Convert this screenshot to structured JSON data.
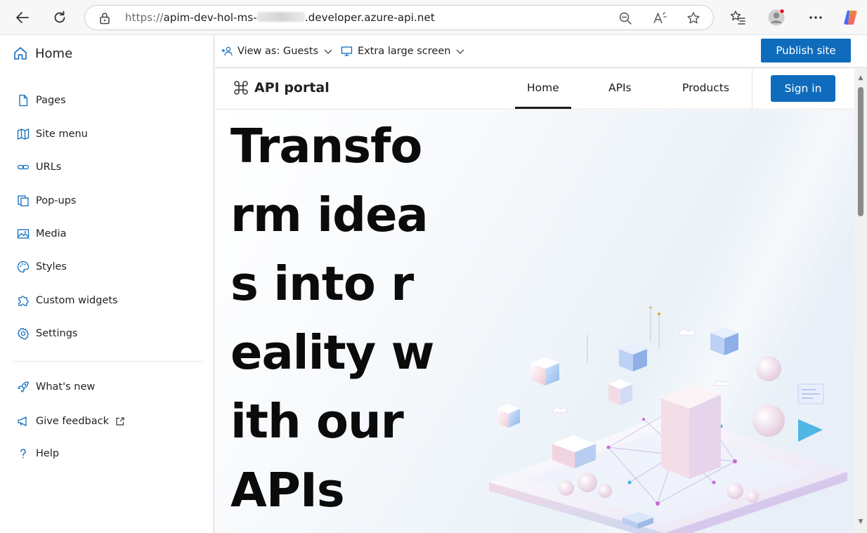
{
  "browser": {
    "url_protocol": "https://",
    "url_host_start": "apim-dev-hol-ms-",
    "url_host_end": ".developer.azure-api.net"
  },
  "sidebar": {
    "home_label": "Home",
    "items": [
      {
        "label": "Pages",
        "icon": "page-icon"
      },
      {
        "label": "Site menu",
        "icon": "map-icon"
      },
      {
        "label": "URLs",
        "icon": "link-icon"
      },
      {
        "label": "Pop-ups",
        "icon": "popup-icon"
      },
      {
        "label": "Media",
        "icon": "image-icon"
      },
      {
        "label": "Styles",
        "icon": "palette-icon"
      },
      {
        "label": "Custom widgets",
        "icon": "puzzle-icon"
      },
      {
        "label": "Settings",
        "icon": "gear-icon"
      }
    ],
    "footer_items": [
      {
        "label": "What's new",
        "icon": "rocket-icon"
      },
      {
        "label": "Give feedback",
        "icon": "megaphone-icon"
      },
      {
        "label": "Help",
        "icon": "question-icon"
      }
    ]
  },
  "toolbar": {
    "view_as": "View as: Guests",
    "screen_size": "Extra large screen",
    "publish_label": "Publish site"
  },
  "portal": {
    "brand": "API portal",
    "tabs": [
      "Home",
      "APIs",
      "Products"
    ],
    "active_tab": "Home",
    "signin_label": "Sign in",
    "hero_title": "Transform ideas into reality with our APIs"
  },
  "colors": {
    "accent": "#0f6cbd",
    "sidebar_border": "#cfcfcf",
    "hero_text": "#0b0b0b"
  }
}
